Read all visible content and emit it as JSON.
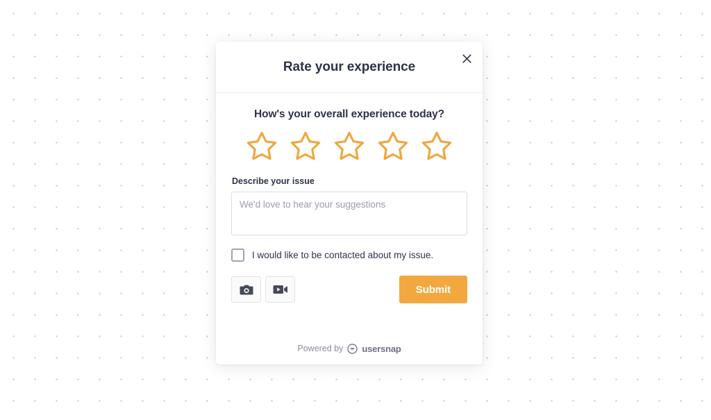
{
  "background": {
    "pattern": "dot-grid",
    "dot_color": "#c8c8cf",
    "page_color": "#ffffff"
  },
  "modal": {
    "header": {
      "title": "Rate your experience",
      "close_icon": "close-icon",
      "close_label": "×"
    },
    "rating": {
      "question": "How's your overall experience today?",
      "star_count": 5,
      "selected": 0,
      "star_color": "#f0a63c",
      "star_icon": "star-outline-icon"
    },
    "issue_field": {
      "label": "Describe your issue",
      "placeholder": "We'd love to hear your suggestions",
      "value": ""
    },
    "contact_checkbox": {
      "label": "I would like to be contacted about my issue.",
      "checked": false
    },
    "actions": {
      "screenshot_icon": "camera-icon",
      "screenshot_label": "Take a screenshot",
      "video_icon": "video-camera-icon",
      "video_label": "Record a video",
      "submit_label": "Submit",
      "submit_color": "#f2a83f"
    },
    "footer": {
      "powered_by": "Powered by",
      "brand": "usersnap",
      "brand_icon": "usersnap-smiley-icon"
    }
  }
}
